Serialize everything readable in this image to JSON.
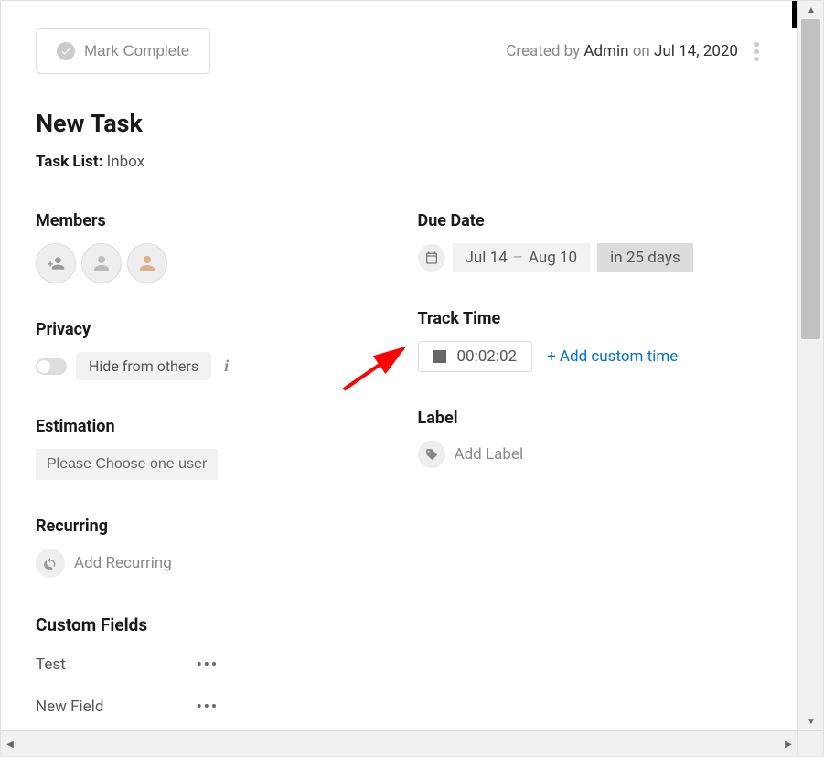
{
  "header": {
    "mark_complete_label": "Mark Complete",
    "created_prefix": "Created by",
    "created_by": "Admin",
    "created_on_word": "on",
    "created_date": "Jul 14, 2020"
  },
  "task": {
    "title": "New Task",
    "tasklist_label": "Task List:",
    "tasklist_value": "Inbox"
  },
  "members": {
    "title": "Members"
  },
  "privacy": {
    "title": "Privacy",
    "hide_label": "Hide from others"
  },
  "estimation": {
    "title": "Estimation",
    "placeholder": "Please Choose one user"
  },
  "recurring": {
    "title": "Recurring",
    "action": "Add Recurring"
  },
  "custom_fields": {
    "title": "Custom Fields",
    "rows": [
      {
        "label": "Test"
      },
      {
        "label": "New Field"
      }
    ]
  },
  "due_date": {
    "title": "Due Date",
    "start": "Jul 14",
    "end": "Aug 10",
    "relative": "in 25 days"
  },
  "track_time": {
    "title": "Track Time",
    "value": "00:02:02",
    "add_custom": "+  Add custom time"
  },
  "label": {
    "title": "Label",
    "action": "Add Label"
  }
}
